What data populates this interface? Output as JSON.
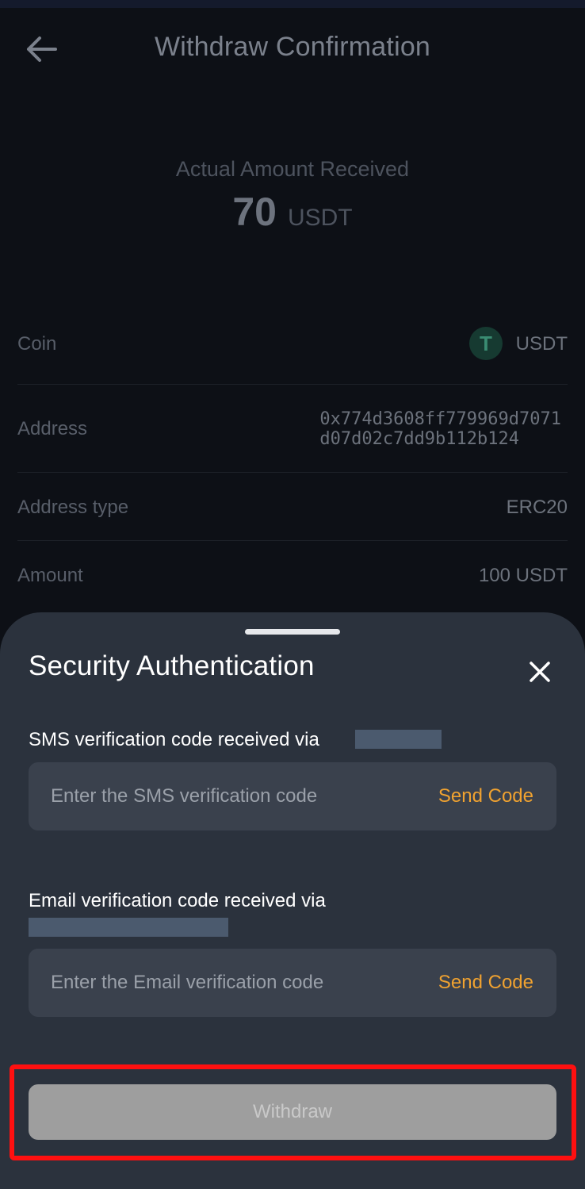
{
  "header": {
    "title": "Withdraw Confirmation"
  },
  "summary": {
    "label": "Actual Amount Received",
    "amount": "70",
    "unit": "USDT"
  },
  "details": {
    "coin": {
      "label": "Coin",
      "value": "USDT",
      "icon": "tether-icon"
    },
    "address": {
      "label": "Address",
      "line1": "0x774d3608ff779969d7071",
      "line2": "d07d02c7dd9b112b124"
    },
    "address_type": {
      "label": "Address type",
      "value": "ERC20"
    },
    "amount": {
      "label": "Amount",
      "value": "100 USDT"
    }
  },
  "sheet": {
    "title": "Security Authentication",
    "sms": {
      "label": "SMS verification code received via",
      "placeholder": "Enter the SMS verification code",
      "value": "",
      "send_label": "Send Code"
    },
    "email": {
      "label": "Email verification code received via",
      "placeholder": "Enter the Email verification code",
      "value": "",
      "send_label": "Send Code"
    },
    "withdraw_label": "Withdraw"
  },
  "colors": {
    "accent": "#f0a230",
    "sheet_bg": "#2b323d",
    "highlight": "#ff1010",
    "disabled_button": "#9e9e9e"
  }
}
